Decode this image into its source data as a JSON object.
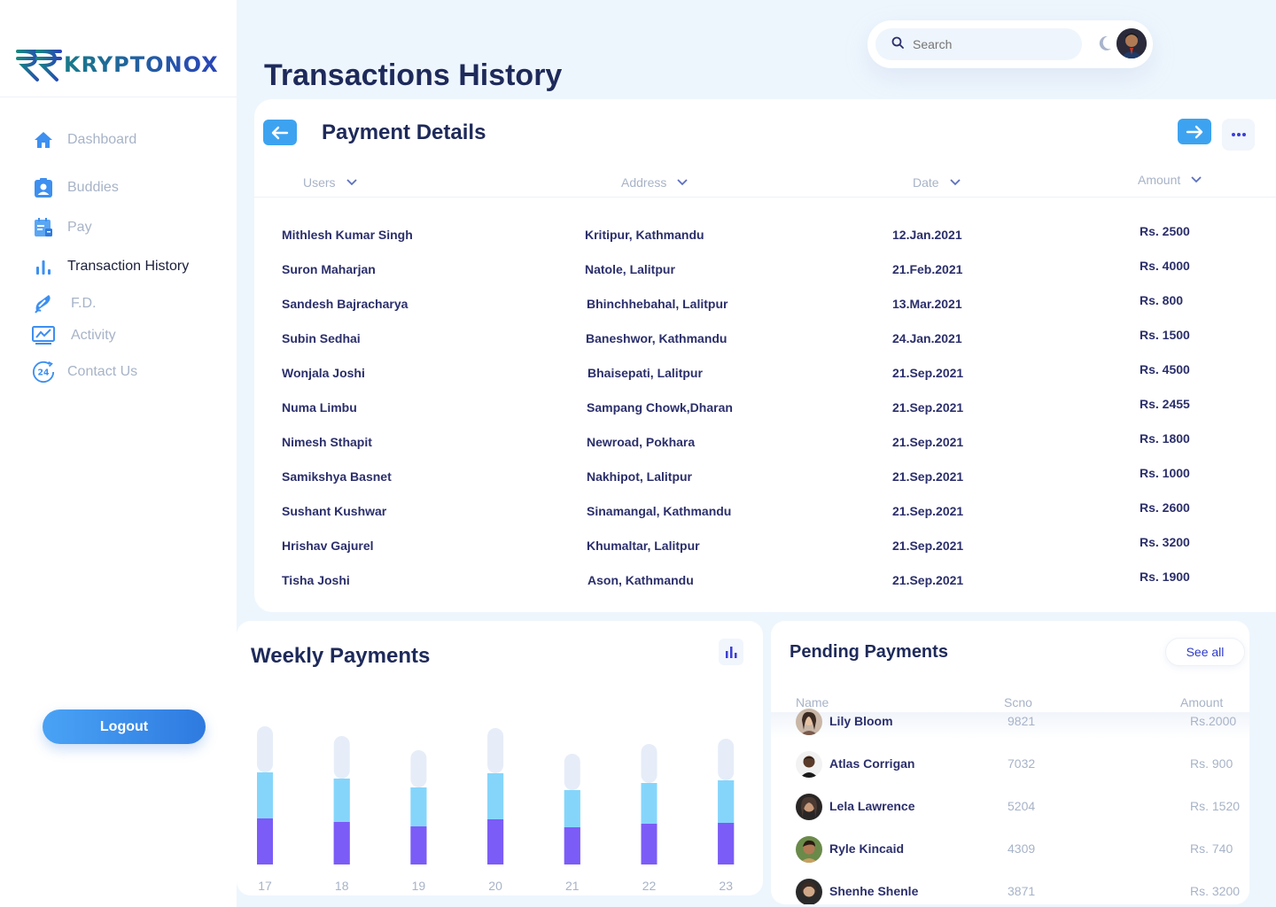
{
  "brand": {
    "name": "KRYPTONOX"
  },
  "sidebar": {
    "items": [
      {
        "label": "Dashboard",
        "icon": "home-icon"
      },
      {
        "label": "Buddies",
        "icon": "contact-card-icon"
      },
      {
        "label": "Pay",
        "icon": "invoice-icon"
      },
      {
        "label": "Transaction History",
        "icon": "bar-chart-icon"
      },
      {
        "label": "F.D.",
        "icon": "pen-icon"
      },
      {
        "label": "Activity",
        "icon": "line-chart-icon"
      },
      {
        "label": "Contact Us",
        "icon": "support-24-icon"
      }
    ],
    "active": "Transaction History",
    "logout_label": "Logout"
  },
  "header": {
    "title": "Transactions History",
    "search_placeholder": "Search"
  },
  "payment_details": {
    "title": "Payment Details",
    "columns": [
      "Users",
      "Address",
      "Date",
      "Amount"
    ],
    "rows": [
      {
        "user": "Mithlesh Kumar Singh",
        "address": "Kritipur, Kathmandu",
        "date": "12.Jan.2021",
        "amount": "Rs. 2500"
      },
      {
        "user": "Suron Maharjan",
        "address": "Natole, Lalitpur",
        "date": "21.Feb.2021",
        "amount": "Rs. 4000"
      },
      {
        "user": "Sandesh Bajracharya",
        "address": "Bhinchhebahal, Lalitpur",
        "date": "13.Mar.2021",
        "amount": "Rs. 800"
      },
      {
        "user": "Subin Sedhai",
        "address": "Baneshwor, Kathmandu",
        "date": "24.Jan.2021",
        "amount": "Rs. 1500"
      },
      {
        "user": "Wonjala Joshi",
        "address": "Bhaisepati, Lalitpur",
        "date": "21.Sep.2021",
        "amount": "Rs. 4500"
      },
      {
        "user": "Numa Limbu",
        "address": "Sampang Chowk,Dharan",
        "date": "21.Sep.2021",
        "amount": "Rs. 2455"
      },
      {
        "user": "Nimesh Sthapit",
        "address": "Newroad, Pokhara",
        "date": "21.Sep.2021",
        "amount": "Rs. 1800"
      },
      {
        "user": "Samikshya Basnet",
        "address": "Nakhipot, Lalitpur",
        "date": "21.Sep.2021",
        "amount": "Rs. 1000"
      },
      {
        "user": "Sushant Kushwar",
        "address": "Sinamangal, Kathmandu",
        "date": "21.Sep.2021",
        "amount": "Rs. 2600"
      },
      {
        "user": "Hrishav Gajurel",
        "address": "Khumaltar, Lalitpur",
        "date": "21.Sep.2021",
        "amount": "Rs. 3200"
      },
      {
        "user": "Tisha Joshi",
        "address": "Ason, Kathmandu",
        "date": "21.Sep.2021",
        "amount": "Rs. 1900"
      }
    ]
  },
  "weekly": {
    "title": "Weekly Payments"
  },
  "chart_data": {
    "type": "bar",
    "title": "Weekly Payments",
    "categories": [
      "17",
      "18",
      "19",
      "20",
      "21",
      "22",
      "23"
    ],
    "series": [
      {
        "values": [
          52,
          48,
          43,
          51,
          42,
          46,
          47
        ]
      },
      {
        "values": [
          52,
          49,
          44,
          52,
          42,
          46,
          48
        ]
      },
      {
        "values": [
          52,
          48,
          42,
          51,
          41,
          44,
          47
        ]
      }
    ],
    "stacked": true,
    "colors": [
      "#7b5cf7",
      "#85d5fb",
      "#e6edf8"
    ],
    "ylim": [
      0,
      160
    ],
    "grid": false,
    "legend": "none"
  },
  "pending": {
    "title": "Pending Payments",
    "see_all": "See all",
    "columns": [
      "Name",
      "Scno",
      "Amount"
    ],
    "rows": [
      {
        "name": "Lily Bloom",
        "scno": "9821",
        "amount": "Rs.2000"
      },
      {
        "name": "Atlas Corrigan",
        "scno": "7032",
        "amount": "Rs. 900"
      },
      {
        "name": "Lela Lawrence",
        "scno": "5204",
        "amount": "Rs. 1520"
      },
      {
        "name": "Ryle Kincaid",
        "scno": "4309",
        "amount": "Rs. 740"
      },
      {
        "name": "Shenhe Shenle",
        "scno": "3871",
        "amount": "Rs. 3200"
      }
    ]
  },
  "colors": {
    "accent_blue": "#3da3f0",
    "nav_text": "#a7b3c7",
    "title_navy": "#1e2a5a",
    "bar_purple": "#7b5cf7",
    "bar_cyan": "#85d5fb",
    "bar_light": "#e6edf8"
  }
}
